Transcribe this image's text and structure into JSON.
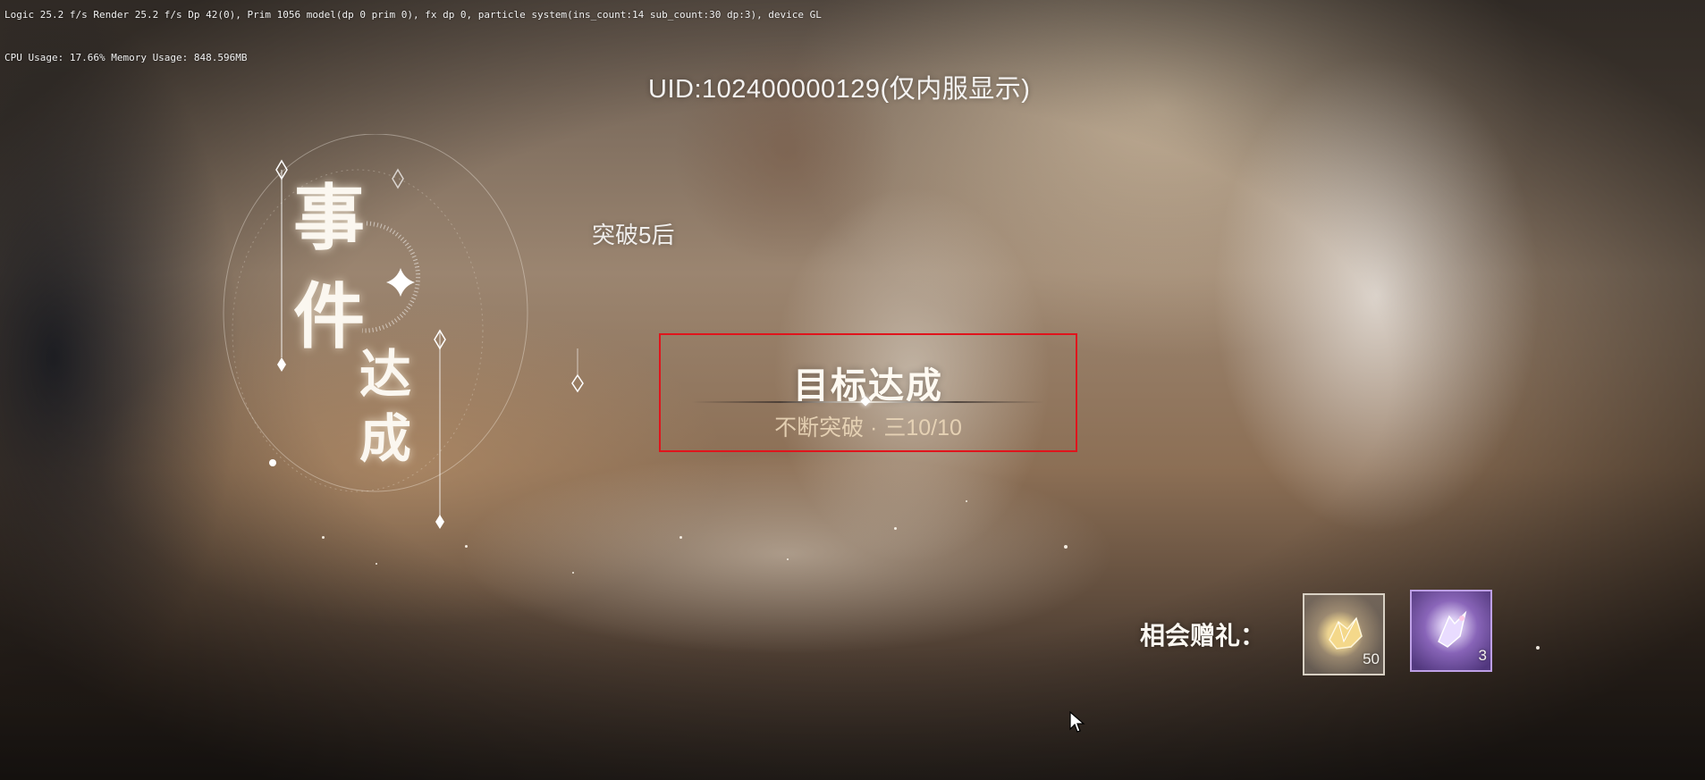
{
  "debug": {
    "line1": "Logic 25.2 f/s  Render 25.2 f/s  Dp 42(0), Prim 1056 model(dp 0 prim 0), fx dp 0, particle system(ins_count:14 sub_count:30 dp:3), device GL",
    "line2": "CPU Usage: 17.66%  Memory Usage: 848.596MB"
  },
  "uid": "UID:102400000129(仅内服显示)",
  "breakthrough_label": "突破5后",
  "event": {
    "char1": "事",
    "char2": "件",
    "char3": "达",
    "char4": "成"
  },
  "goal": {
    "title": "目标达成",
    "subtitle": "不断突破 · 三10/10"
  },
  "gifts": {
    "label": "相会赠礼：",
    "items": [
      {
        "icon": "gold-crystal-icon",
        "count": "50"
      },
      {
        "icon": "purple-shard-icon",
        "count": "3"
      }
    ]
  },
  "colors": {
    "highlight_box": "#e0141c",
    "gift2_frame": "#c8aaf0"
  }
}
